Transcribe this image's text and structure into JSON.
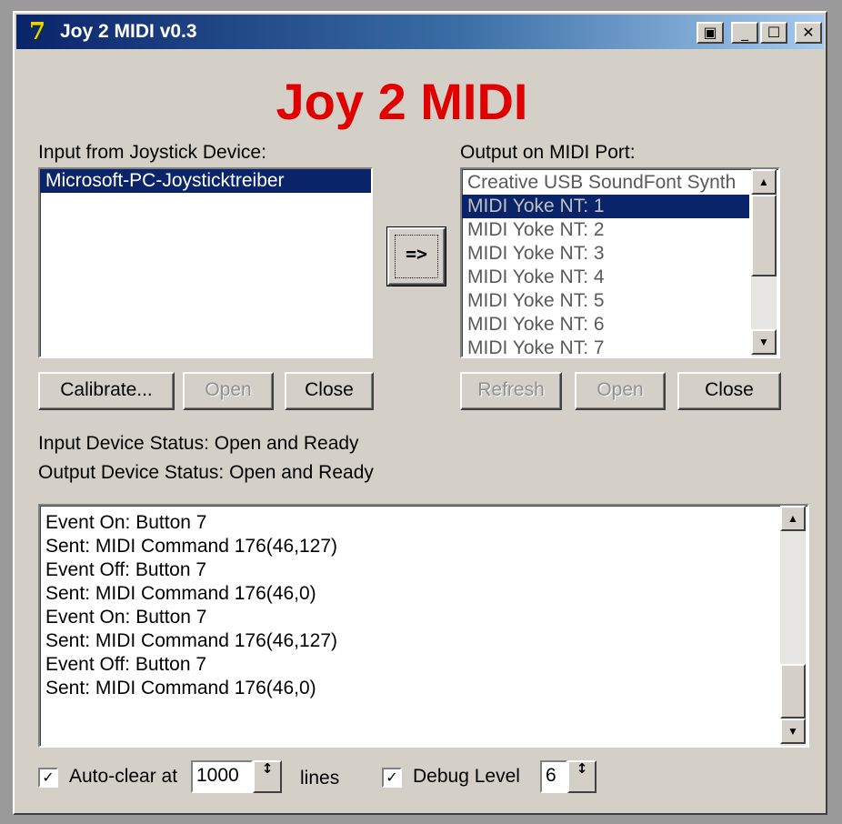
{
  "window": {
    "title": "Joy 2 MIDI v0.3",
    "icon": "7b-app-icon",
    "controls": {
      "restore": "▣",
      "minimize": "_",
      "maximize": "☐",
      "close": "✕"
    }
  },
  "heading": "Joy 2 MIDI",
  "input_panel": {
    "label": "Input from Joystick Device:",
    "devices": [
      {
        "name": "Microsoft-PC-Joysticktreiber",
        "selected": true
      }
    ],
    "buttons": {
      "calibrate": "Calibrate...",
      "open": "Open",
      "close": "Close"
    }
  },
  "connect_button": "=>",
  "output_panel": {
    "label": "Output on MIDI Port:",
    "ports": [
      {
        "name": "Creative USB SoundFont Synth",
        "selected": false
      },
      {
        "name": "MIDI Yoke NT:  1",
        "selected": true
      },
      {
        "name": "MIDI Yoke NT:  2",
        "selected": false
      },
      {
        "name": "MIDI Yoke NT:  3",
        "selected": false
      },
      {
        "name": "MIDI Yoke NT:  4",
        "selected": false
      },
      {
        "name": "MIDI Yoke NT:  5",
        "selected": false
      },
      {
        "name": "MIDI Yoke NT:  6",
        "selected": false
      },
      {
        "name": "MIDI Yoke NT:  7",
        "selected": false
      }
    ],
    "buttons": {
      "refresh": "Refresh",
      "open": "Open",
      "close": "Close"
    }
  },
  "status": {
    "input": "Input Device Status: Open and Ready",
    "output": "Output Device Status: Open and Ready"
  },
  "log": [
    "Event On: Button 7",
    "Sent: MIDI Command 176(46,127)",
    "Event Off: Button 7",
    "Sent: MIDI Command 176(46,0)",
    "Event On: Button 7",
    "Sent: MIDI Command 176(46,127)",
    "Event Off: Button 7",
    "Sent: MIDI Command 176(46,0)"
  ],
  "footer": {
    "autoclear_label": "Auto-clear at",
    "autoclear_checked": true,
    "autoclear_value": "1000",
    "lines_label": "lines",
    "debug_label": "Debug Level",
    "debug_checked": true,
    "debug_value": "6"
  },
  "glyphs": {
    "check": "✓",
    "up": "▲",
    "down": "▼",
    "spin": "↕"
  }
}
